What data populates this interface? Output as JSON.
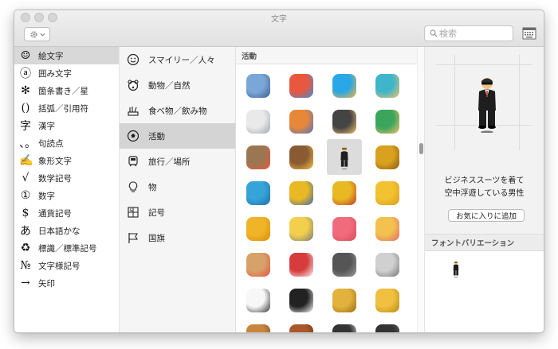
{
  "window": {
    "title": "文字"
  },
  "toolbar": {
    "search_placeholder": "検索"
  },
  "categories": [
    {
      "glyph": "☺",
      "label": "絵文字"
    },
    {
      "glyph": "ⓐ",
      "label": "囲み文字"
    },
    {
      "glyph": "✻",
      "label": "箇条書き／星"
    },
    {
      "glyph": "()",
      "label": "括弧／引用符"
    },
    {
      "glyph": "字",
      "label": "漢字"
    },
    {
      "glyph": "、。",
      "label": "句読点"
    },
    {
      "glyph": "✍",
      "label": "象形文字"
    },
    {
      "glyph": "√",
      "label": "数学記号"
    },
    {
      "glyph": "①",
      "label": "数字"
    },
    {
      "glyph": "$",
      "label": "通貨記号"
    },
    {
      "glyph": "あ",
      "label": "日本語かな"
    },
    {
      "glyph": "♻",
      "label": "標識／標準記号"
    },
    {
      "glyph": "№",
      "label": "文字様記号"
    },
    {
      "glyph": "→",
      "label": "矢印"
    }
  ],
  "subcategories": [
    {
      "icon": "smiley-icon",
      "label": "スマイリー／人々"
    },
    {
      "icon": "bear-icon",
      "label": "動物／自然"
    },
    {
      "icon": "food-icon",
      "label": "食べ物／飲み物"
    },
    {
      "icon": "soccer-ball-icon",
      "label": "活動"
    },
    {
      "icon": "train-icon",
      "label": "旅行／場所"
    },
    {
      "icon": "lightbulb-icon",
      "label": "物"
    },
    {
      "icon": "symbols-icon",
      "label": "記号"
    },
    {
      "icon": "flag-icon",
      "label": "国旗"
    }
  ],
  "grid": {
    "header": "活動",
    "emojis": [
      {
        "name": "fishing-pole-emoji",
        "c1": "#7aa7d8",
        "c2": "#3b5f8f"
      },
      {
        "name": "rowboat-emoji",
        "c1": "#e9573f",
        "c2": "#3d8fd6"
      },
      {
        "name": "swimmer-emoji",
        "c1": "#2aa7e6",
        "c2": "#f4b63f"
      },
      {
        "name": "surfer-emoji",
        "c1": "#3fb5c9",
        "c2": "#f5c26b"
      },
      {
        "name": "bath-emoji",
        "c1": "#e9e9e9",
        "c2": "#9aa7b2"
      },
      {
        "name": "basketball-player-emoji",
        "c1": "#e7873a",
        "c2": "#4b74c8"
      },
      {
        "name": "weight-lifter-emoji",
        "c1": "#444444",
        "c2": "#f2c36b"
      },
      {
        "name": "bicyclist-emoji",
        "c1": "#3ba55c",
        "c2": "#f2c36b"
      },
      {
        "name": "mountain-bicyclist-emoji",
        "c1": "#9b7653",
        "c2": "#e9573f"
      },
      {
        "name": "horse-racing-emoji",
        "c1": "#8a5a32",
        "c2": "#f3c34b"
      },
      {
        "name": "levitating-man-emoji",
        "c1": "#222222",
        "c2": "#f1c27d"
      },
      {
        "name": "trophy-emoji",
        "c1": "#d9a11f",
        "c2": "#8a5a12"
      },
      {
        "name": "running-shirt-emoji",
        "c1": "#36a3d9",
        "c2": "#1d6fa5"
      },
      {
        "name": "sports-medal-emoji",
        "c1": "#e8b923",
        "c2": "#3a65b5"
      },
      {
        "name": "military-medal-emoji",
        "c1": "#e8b923",
        "c2": "#c0392b"
      },
      {
        "name": "reminder-ribbon-emoji",
        "c1": "#f2c230",
        "c2": "#d99a1a"
      },
      {
        "name": "rosette-emoji",
        "c1": "#f0b429",
        "c2": "#d98e04"
      },
      {
        "name": "admission-tickets-emoji",
        "c1": "#f3d04b",
        "c2": "#7a7a7a"
      },
      {
        "name": "ticket-emoji",
        "c1": "#f06c7c",
        "c2": "#d94b5b"
      },
      {
        "name": "performing-arts-emoji",
        "c1": "#f2c14e",
        "c2": "#e56b6f"
      },
      {
        "name": "artist-palette-emoji",
        "c1": "#d7a26a",
        "c2": "#e5533d"
      },
      {
        "name": "circus-tent-emoji",
        "c1": "#d63c3c",
        "c2": "#f5f5f5"
      },
      {
        "name": "microphone-emoji",
        "c1": "#555555",
        "c2": "#9a9a9a"
      },
      {
        "name": "headphone-emoji",
        "c1": "#d0d0d0",
        "c2": "#777777"
      },
      {
        "name": "musical-score-emoji",
        "c1": "#f7f7f7",
        "c2": "#333333"
      },
      {
        "name": "musical-keyboard-emoji",
        "c1": "#222222",
        "c2": "#ffffff"
      },
      {
        "name": "saxophone-emoji",
        "c1": "#e3b23c",
        "c2": "#9a6d12"
      },
      {
        "name": "trumpet-emoji",
        "c1": "#f0c040",
        "c2": "#b58a14"
      },
      {
        "name": "guitar-emoji",
        "c1": "#c8843e",
        "c2": "#7a4a1c"
      },
      {
        "name": "violin-emoji",
        "c1": "#a8582a",
        "c2": "#5c2c10"
      },
      {
        "name": "clapper-board-emoji",
        "c1": "#333333",
        "c2": "#eeeeee"
      },
      {
        "name": "video-game-emoji",
        "c1": "#333333",
        "c2": "#666666"
      }
    ]
  },
  "detail": {
    "name_line1": "ビジネススーツを着て",
    "name_line2": "空中浮遊している男性",
    "favorite_label": "お気に入りに追加",
    "variations_header": "フォントバリエーション"
  },
  "colors": {
    "sidebar_selected": "#d8d8d8",
    "grid_selected": "#dcdcdc"
  }
}
